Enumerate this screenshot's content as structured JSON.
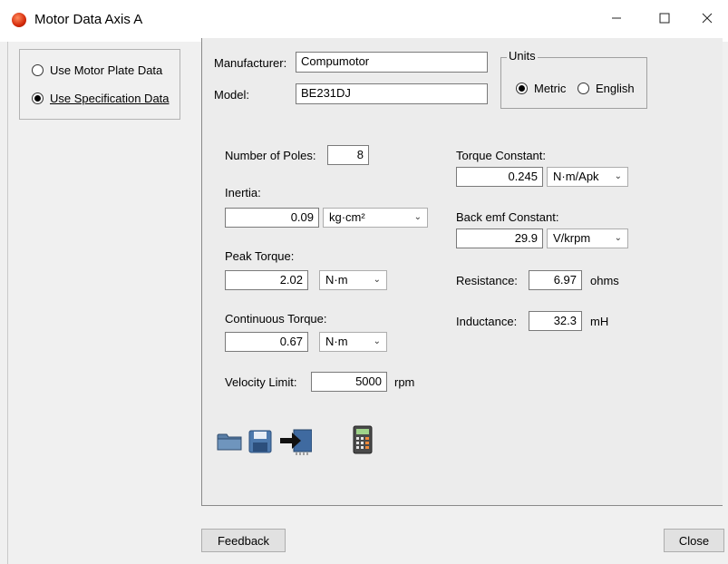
{
  "window": {
    "title": "Motor Data Axis A"
  },
  "source": {
    "options": [
      {
        "label": "Use Motor Plate Data",
        "selected": false
      },
      {
        "label": "Use Specification Data",
        "selected": true
      }
    ]
  },
  "manufacturer": {
    "label": "Manufacturer:",
    "value": "Compumotor"
  },
  "model": {
    "label": "Model:",
    "value": "BE231DJ"
  },
  "units": {
    "legend": "Units",
    "options": [
      {
        "label": "Metric",
        "selected": true
      },
      {
        "label": "English",
        "selected": false
      }
    ]
  },
  "poles": {
    "label": "Number of Poles:",
    "value": "8"
  },
  "inertia": {
    "label": "Inertia:",
    "value": "0.09",
    "unit": "kg·cm²"
  },
  "peak_torque": {
    "label": "Peak Torque:",
    "value": "2.02",
    "unit": "N·m"
  },
  "continuous_torque": {
    "label": "Continuous Torque:",
    "value": "0.67",
    "unit": "N·m"
  },
  "velocity_limit": {
    "label": "Velocity Limit:",
    "value": "5000",
    "unit": "rpm"
  },
  "torque_constant": {
    "label": "Torque Constant:",
    "value": "0.245",
    "unit": "N·m/Apk"
  },
  "back_emf": {
    "label": "Back emf Constant:",
    "value": "29.9",
    "unit": "V/krpm"
  },
  "resistance": {
    "label": "Resistance:",
    "value": "6.97",
    "unit": "ohms"
  },
  "inductance": {
    "label": "Inductance:",
    "value": "32.3",
    "unit": "mH"
  },
  "toolbar": {
    "icons": [
      "folder-icon",
      "save-icon",
      "import-icon",
      "calculator-icon"
    ]
  },
  "footer": {
    "feedback_label": "Feedback",
    "close_label": "Close"
  }
}
